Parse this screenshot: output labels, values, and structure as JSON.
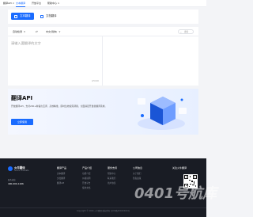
{
  "topnav": {
    "items": [
      {
        "label": "翻译API ∨"
      },
      {
        "label": "文本翻译"
      },
      {
        "label": "开放平台"
      },
      {
        "label": "帮助中心 ∨"
      }
    ]
  },
  "tabs": [
    {
      "label": "文本翻译",
      "active": true
    },
    {
      "label": "文档翻译",
      "active": false
    }
  ],
  "translator": {
    "source_lang": "自动检测",
    "target_lang": "中文(简体)",
    "swap_icon": "swap-icon",
    "search_placeholder": "搜索",
    "input_placeholder": "请输入要翻译的文字",
    "char_count": "0/5000"
  },
  "api_banner": {
    "title": "翻译API",
    "description": "开放翻译API，支持200+种语言互译，高效精准，即时生效按需调用，全面满足开发者翻译需求。",
    "button_label": "立即使用",
    "accent_color": "#1a6cff"
  },
  "footer": {
    "brand": "火牛翻译",
    "brand_sub": "Huoniu Translate",
    "hotline_label": "服务热线",
    "phone": "400-000-1166",
    "columns": [
      {
        "title": "翻译产品",
        "links": [
          "文本翻译",
          "文档翻译",
          "翻译API"
        ]
      },
      {
        "title": "产品介绍",
        "links": [
          "功能介绍",
          "价格说明",
          "开放平台",
          "使用文档"
        ]
      },
      {
        "title": "服务支持",
        "links": [
          "帮助中心",
          "联系我们",
          "用户协议"
        ]
      },
      {
        "title": "公司信息",
        "links": [
          "关于我们",
          "隐私政策"
        ]
      }
    ],
    "qr_title": "关注火牛翻译",
    "qr_label": "扫码关注",
    "copyright": "Copyright © 2024 火牛翻译 版权所有  京ICP备XXXXXXXX号"
  },
  "watermark": "0401号航库"
}
